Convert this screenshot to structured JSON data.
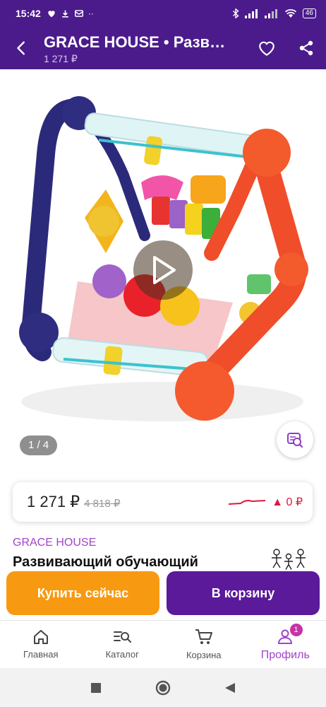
{
  "status_bar": {
    "time": "15:42",
    "battery": "46"
  },
  "app_bar": {
    "title": "GRACE HOUSE • Развивающий обучающий",
    "price": "1 271 ₽"
  },
  "gallery": {
    "counter": "1 / 4"
  },
  "price_card": {
    "current_price": "1 271 ₽",
    "old_price": "4 818 ₽",
    "price_change": "▲ 0 ₽"
  },
  "product": {
    "brand": "GRACE HOUSE",
    "name": "Развивающий обучающий"
  },
  "actions": {
    "buy_now": "Купить сейчас",
    "add_to_cart": "В корзину"
  },
  "bottom_nav": {
    "items": [
      {
        "label": "Главная",
        "icon": "home-icon"
      },
      {
        "label": "Каталог",
        "icon": "catalog-search-icon"
      },
      {
        "label": "Корзина",
        "icon": "cart-icon"
      },
      {
        "label": "Профиль",
        "icon": "profile-icon",
        "badge": "1"
      }
    ]
  },
  "colors": {
    "header": "#4b1b8c",
    "buy_button": "#f79a12",
    "cart_button": "#5a1a9a",
    "accent": "#a044c9",
    "price_up": "#e0173f"
  }
}
